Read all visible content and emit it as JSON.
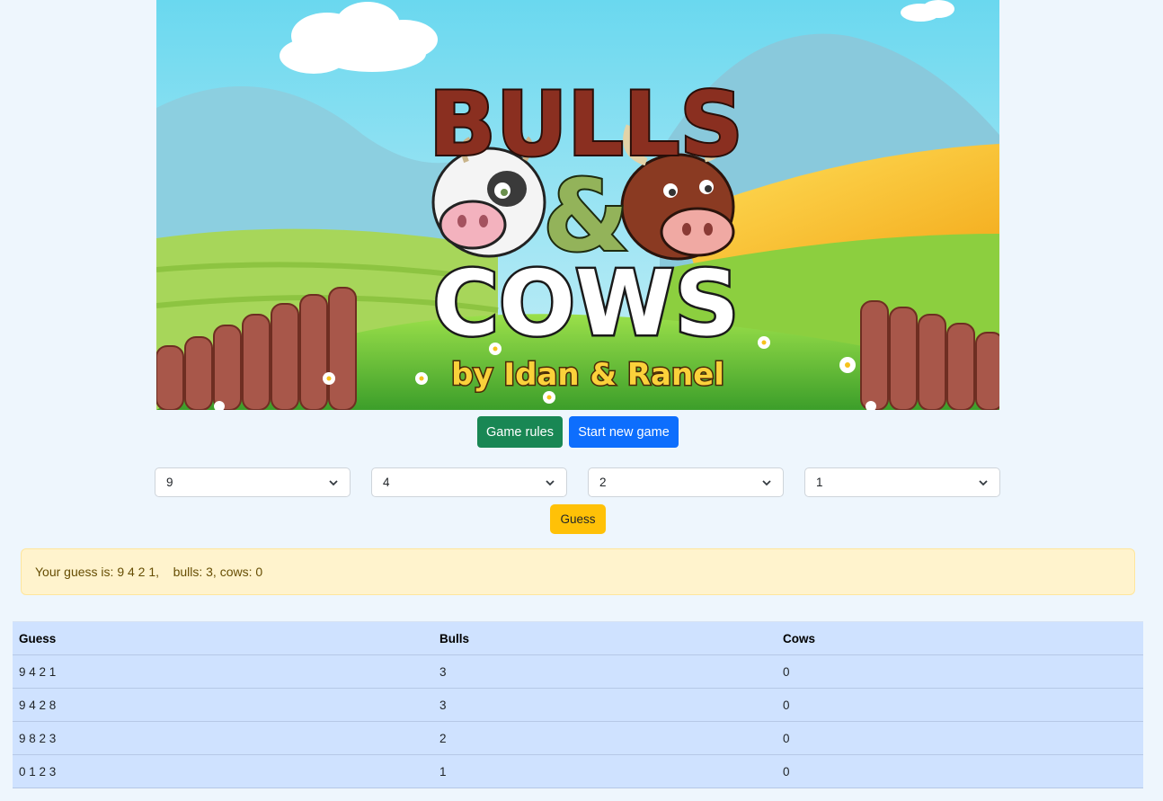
{
  "banner": {
    "title_line1": "BULLS",
    "ampersand": "&",
    "title_line2": "COWS",
    "credit": "by Idan & Ranel"
  },
  "buttons": {
    "rules_label": "Game rules",
    "new_game_label": "Start new game",
    "guess_label": "Guess"
  },
  "digit_selects": [
    "9",
    "4",
    "2",
    "1"
  ],
  "result_message": "Your guess is: 9 4 2 1,    bulls: 3, cows: 0",
  "history": {
    "headers": [
      "Guess",
      "Bulls",
      "Cows"
    ],
    "rows": [
      [
        "9 4 2 1",
        "3",
        "0"
      ],
      [
        "9 4 2 8",
        "3",
        "0"
      ],
      [
        "9 8 2 3",
        "2",
        "0"
      ],
      [
        "0 1 2 3",
        "1",
        "0"
      ]
    ]
  },
  "colors": {
    "page_bg": "#eef6fd",
    "rules_button": "#198754",
    "new_game_button": "#0d6efd",
    "guess_button": "#ffc107",
    "alert_bg": "#fff3cd",
    "table_bg": "#cfe2ff"
  }
}
